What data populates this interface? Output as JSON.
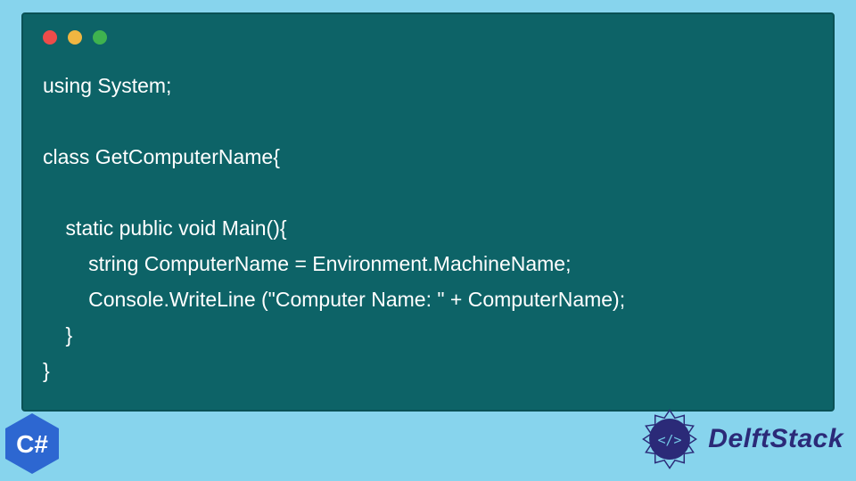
{
  "colors": {
    "page_bg": "#87d4ed",
    "window_bg": "#0d6367",
    "window_border": "#0a5155",
    "code_text": "#ffffff",
    "traffic_red": "#ed4c4a",
    "traffic_yellow": "#f0b641",
    "traffic_green": "#3fb24f",
    "brand_text": "#2b2a78",
    "csharp_fill": "#2d67d1"
  },
  "code": {
    "lines": [
      "using System;",
      "",
      "class GetComputerName{",
      "",
      "    static public void Main(){",
      "        string ComputerName = Environment.MachineName;",
      "        Console.WriteLine (\"Computer Name: \" + ComputerName);",
      "    }",
      "}"
    ]
  },
  "badges": {
    "csharp_label": "C#"
  },
  "brand": {
    "name": "DelftStack"
  }
}
